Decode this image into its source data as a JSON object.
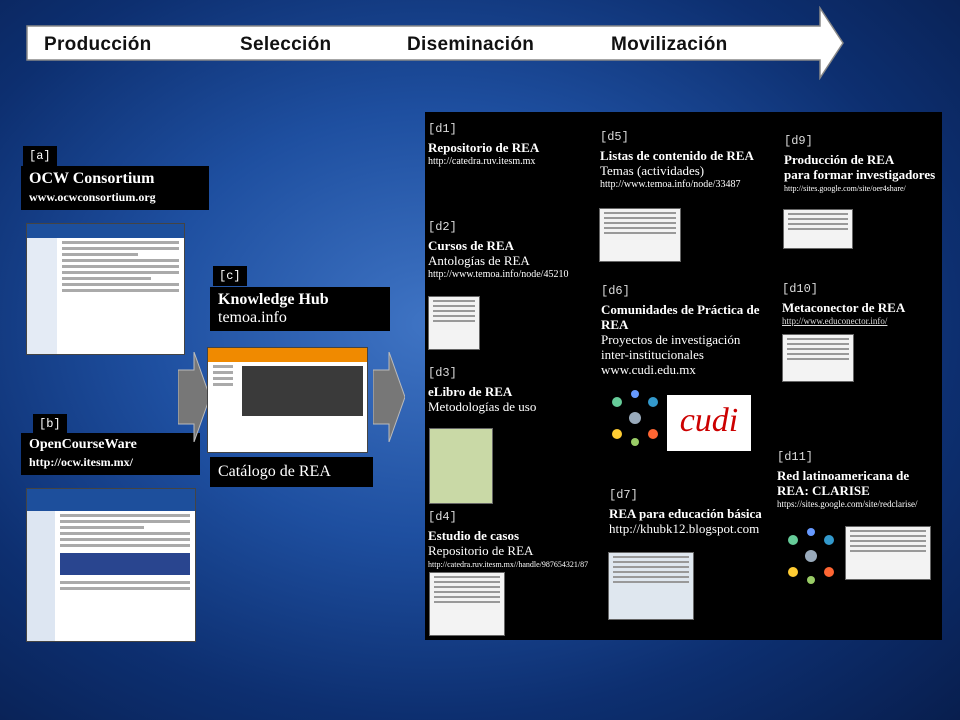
{
  "stages": [
    "Producción",
    "Selección",
    "Diseminación",
    "Movilización"
  ],
  "left": {
    "a": {
      "tag": "[a]",
      "title": "OCW Consortium",
      "url": "www.ocwconsortium.org"
    },
    "b": {
      "tag": "[b]",
      "title": "OpenCourseWare",
      "url": "http://ocw.itesm.mx/"
    },
    "c": {
      "tag": "[c]",
      "title": "Knowledge Hub",
      "url": "temoa.info",
      "caption": "Catálogo de REA"
    }
  },
  "sections": {
    "d1": {
      "id": "[d1]",
      "h": "Repositorio de REA",
      "u": "http://catedra.ruv.itesm.mx"
    },
    "d2": {
      "id": "[d2]",
      "h": "Cursos de REA",
      "s": "Antologías de REA",
      "u": "http://www.temoa.info/node/45210"
    },
    "d3": {
      "id": "[d3]",
      "h": "eLibro de REA",
      "s": "Metodologías de uso"
    },
    "d4": {
      "id": "[d4]",
      "h": "Estudio de casos",
      "s": "Repositorio de REA",
      "u": "http://catedra.ruv.itesm.mx//handle/987654321/87"
    },
    "d5": {
      "id": "[d5]",
      "h": "Listas de contenido de REA",
      "s": "Temas (actividades)",
      "u": "http://www.temoa.info/node/33487"
    },
    "d6": {
      "id": "[d6]",
      "h": "Comunidades de Práctica de REA",
      "s1": "Proyectos de investigación",
      "s2": "inter-institucionales",
      "s3": "www.cudi.edu.mx",
      "logo": "cudi"
    },
    "d7": {
      "id": "[d7]",
      "h": "REA para educación básica",
      "s": "http://khubk12.blogspot.com"
    },
    "d9": {
      "id": "[d9]",
      "h1": "Producción de REA",
      "h2": "para formar investigadores",
      "u": "http://sites.google.com/site/oer4share/"
    },
    "d10": {
      "id": "[d10]",
      "h": "Metaconector de REA",
      "u": "http://www.educonector.info/"
    },
    "d11": {
      "id": "[d11]",
      "h1": "Red latinoamericana de",
      "h2": "REA: CLARISE",
      "u": "https://sites.google.com/site/redclarise/"
    }
  },
  "colors": {
    "accent": "#f08a00",
    "ocw_blue": "#1d4f9c"
  }
}
